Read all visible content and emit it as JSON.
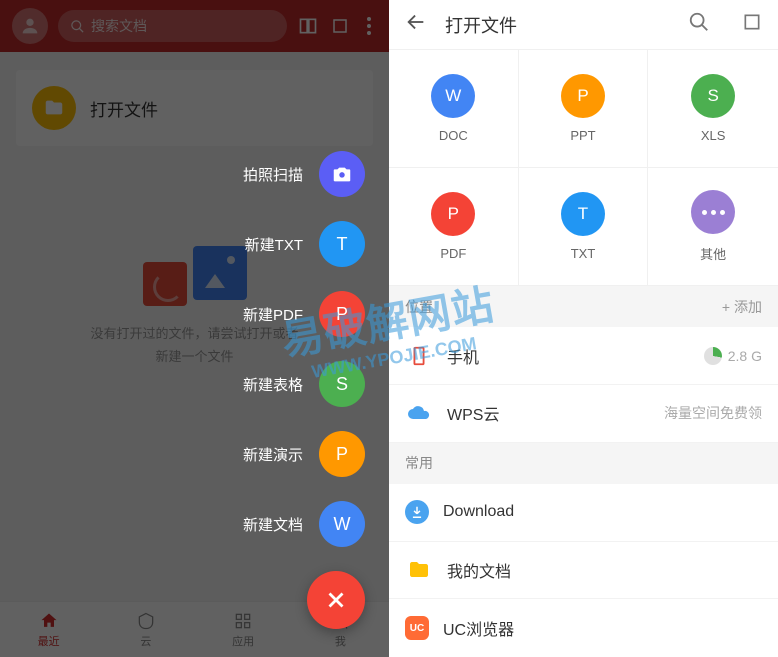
{
  "left": {
    "search_placeholder": "搜索文档",
    "open_file_title": "打开文件",
    "empty_line1": "没有打开过的文件，请尝试打开或者",
    "empty_line2": "新建一个文件",
    "nav": [
      {
        "label": "最近",
        "active": true
      },
      {
        "label": "云",
        "active": false
      },
      {
        "label": "应用",
        "active": false
      },
      {
        "label": "我",
        "active": false
      }
    ],
    "fab": {
      "items": [
        {
          "label": "拍照扫描",
          "color": "#5b5ef5",
          "glyph": "camera"
        },
        {
          "label": "新建TXT",
          "color": "#2196f3",
          "glyph": "T"
        },
        {
          "label": "新建PDF",
          "color": "#f44336",
          "glyph": "P"
        },
        {
          "label": "新建表格",
          "color": "#4caf50",
          "glyph": "S"
        },
        {
          "label": "新建演示",
          "color": "#ff9800",
          "glyph": "P"
        },
        {
          "label": "新建文档",
          "color": "#4285f4",
          "glyph": "W"
        }
      ]
    }
  },
  "right": {
    "title": "打开文件",
    "types": [
      {
        "label": "DOC",
        "color": "#4285f4",
        "glyph": "W"
      },
      {
        "label": "PPT",
        "color": "#ff9800",
        "glyph": "P"
      },
      {
        "label": "XLS",
        "color": "#4caf50",
        "glyph": "S"
      },
      {
        "label": "PDF",
        "color": "#f44336",
        "glyph": "P"
      },
      {
        "label": "TXT",
        "color": "#2196f3",
        "glyph": "T"
      },
      {
        "label": "其他",
        "color": "#9b7fd4",
        "glyph": "more"
      }
    ],
    "sections": {
      "location_title": "位置",
      "add_text": "+ 添加",
      "common_title": "常用"
    },
    "locations": [
      {
        "title": "手机",
        "meta": "2.8 G",
        "icon": "phone"
      },
      {
        "title": "WPS云",
        "meta": "海量空间免费领",
        "icon": "cloud"
      }
    ],
    "common": [
      {
        "title": "Download",
        "icon": "down"
      },
      {
        "title": "我的文档",
        "icon": "folder"
      },
      {
        "title": "UC浏览器",
        "icon": "uc"
      }
    ]
  },
  "watermark": {
    "main": "易破解网站",
    "sub": "WWW.YPOJIE.COM"
  }
}
